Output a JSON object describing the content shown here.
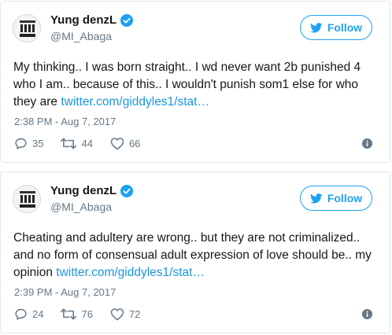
{
  "tweets": [
    {
      "display_name": "Yung denzL",
      "handle": "@MI_Abaga",
      "follow_label": "Follow",
      "text": "My thinking.. I was born straight.. I wd never want 2b punished 4 who I am.. because of this.. I wouldn't punish som1 else for who they are ",
      "link_text": "twitter.com/giddyles1/stat…",
      "timestamp": "2:38 PM - Aug 7, 2017",
      "replies": "35",
      "retweets": "44",
      "likes": "66"
    },
    {
      "display_name": "Yung denzL",
      "handle": "@MI_Abaga",
      "follow_label": "Follow",
      "text": "Cheating and adultery are wrong.. but they are not criminalized.. and no form of consensual adult expression of love should be.. my opinion ",
      "link_text": "twitter.com/giddyles1/stat…",
      "timestamp": "2:39 PM - Aug 7, 2017",
      "replies": "24",
      "retweets": "76",
      "likes": "72"
    }
  ],
  "colors": {
    "accent": "#1da1f2",
    "link": "#1b95e0",
    "muted": "#657786",
    "text": "#14171a",
    "border": "#e1e8ed"
  },
  "icons": [
    "verified-icon",
    "twitter-bird-icon",
    "reply-icon",
    "retweet-icon",
    "like-icon",
    "info-icon"
  ]
}
